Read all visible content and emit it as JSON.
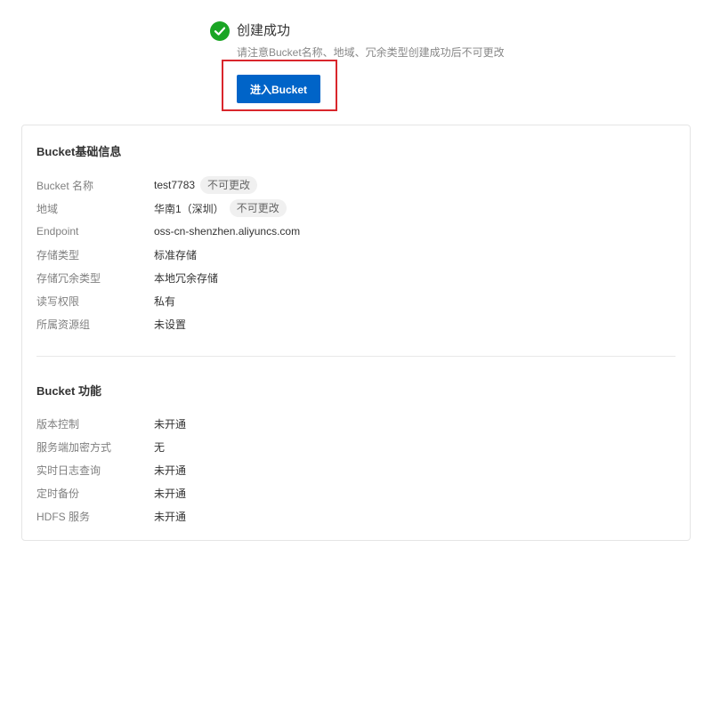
{
  "success": {
    "title": "创建成功",
    "subtitle": "请注意Bucket名称、地域、冗余类型创建成功后不可更改",
    "icon": "check-circle-icon",
    "color": "#1aa524"
  },
  "enter_button": {
    "label": "进入Bucket",
    "color": "#0064c8",
    "highlight_color": "#d9262c"
  },
  "basic_info": {
    "title": "Bucket基础信息",
    "rows": [
      {
        "label": "Bucket 名称",
        "value": "test7783",
        "tag": "不可更改"
      },
      {
        "label": "地域",
        "value": "华南1（深圳）",
        "tag": "不可更改"
      },
      {
        "label": "Endpoint",
        "value": "oss-cn-shenzhen.aliyuncs.com"
      },
      {
        "label": "存储类型",
        "value": "标准存储"
      },
      {
        "label": "存储冗余类型",
        "value": "本地冗余存储"
      },
      {
        "label": "读写权限",
        "value": "私有"
      },
      {
        "label": "所属资源组",
        "value": "未设置"
      }
    ]
  },
  "features": {
    "title": "Bucket 功能",
    "rows": [
      {
        "label": "版本控制",
        "value": "未开通"
      },
      {
        "label": "服务端加密方式",
        "value": "无"
      },
      {
        "label": "实时日志查询",
        "value": "未开通"
      },
      {
        "label": "定时备份",
        "value": "未开通"
      },
      {
        "label": "HDFS 服务",
        "value": "未开通"
      }
    ]
  }
}
